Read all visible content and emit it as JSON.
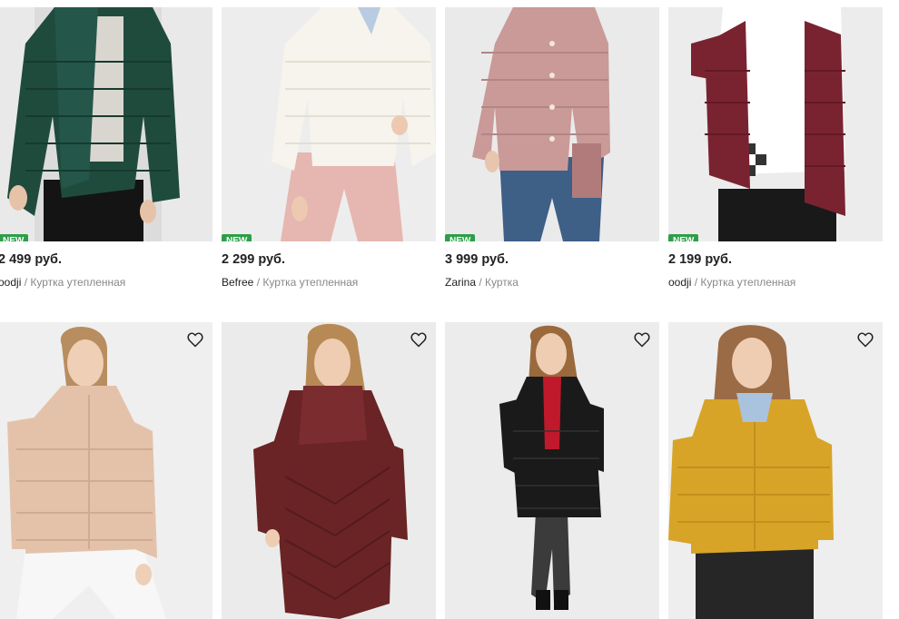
{
  "products": [
    {
      "badge": "NEW",
      "price": "2 499 руб.",
      "brand": "oodji",
      "separator": " / ",
      "title": "Куртка утепленная",
      "jacket_color": "#1f4b3d",
      "bg_color": "#e9e9e9"
    },
    {
      "badge": "NEW",
      "price": "2 299 руб.",
      "brand": "Befree",
      "separator": " / ",
      "title": "Куртка утепленная",
      "jacket_color": "#f6f4ec",
      "bg_color": "#ededed"
    },
    {
      "badge": "NEW",
      "price": "3 999 руб.",
      "brand": "Zarina",
      "separator": " / ",
      "title": "Куртка",
      "jacket_color": "#c99a98",
      "bg_color": "#eaeaea"
    },
    {
      "badge": "NEW",
      "price": "2 199 руб.",
      "brand": "oodji",
      "separator": " / ",
      "title": "Куртка утепленная",
      "jacket_color": "#7a2330",
      "bg_color": "#ececec"
    },
    {
      "jacket_color": "#e4c2aa",
      "bg_color": "#efefef",
      "favorite_icon": "heart-outline-icon"
    },
    {
      "jacket_color": "#6a2426",
      "bg_color": "#ebebeb",
      "favorite_icon": "heart-outline-icon"
    },
    {
      "jacket_color": "#1a1a1a",
      "bg_color": "#ececec",
      "favorite_icon": "heart-outline-icon"
    },
    {
      "jacket_color": "#d8a428",
      "bg_color": "#eeeeee",
      "favorite_icon": "heart-outline-icon"
    }
  ],
  "colors": {
    "new_badge": "#2e9e49",
    "price_text": "#222222",
    "meta_text": "#888888"
  }
}
